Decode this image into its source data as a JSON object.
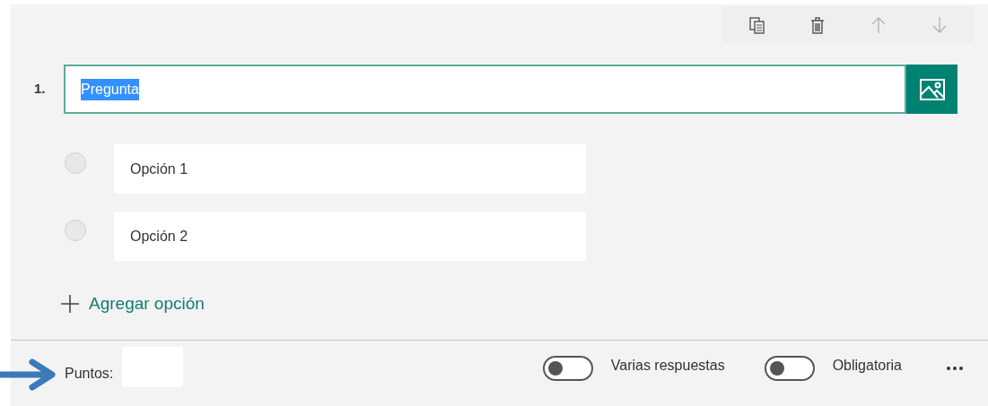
{
  "toolbar": {
    "buttons": [
      {
        "kind": "copy",
        "disabled": false
      },
      {
        "kind": "delete",
        "disabled": false
      },
      {
        "kind": "up",
        "disabled": true
      },
      {
        "kind": "down",
        "disabled": true
      }
    ]
  },
  "question": {
    "number": "1.",
    "value": "Pregunta",
    "selected_text": true
  },
  "options": [
    {
      "value": "Opción 1",
      "selected": false
    },
    {
      "value": "Opción 2",
      "selected": false
    }
  ],
  "add_option": "Agregar opción",
  "footer": {
    "points_label": "Puntos:",
    "toggles": [
      {
        "label": "Varias respuestas",
        "on": false
      },
      {
        "label": "Obligatoria",
        "on": false
      }
    ]
  }
}
